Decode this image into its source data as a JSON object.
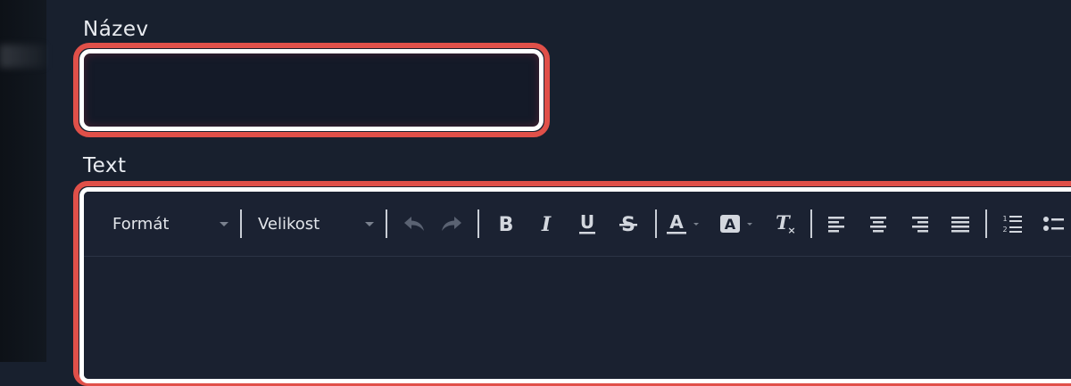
{
  "form": {
    "name_label": "Název",
    "name_value": "",
    "text_label": "Text"
  },
  "toolbar": {
    "format_label": "Formát",
    "size_label": "Velikost",
    "buttons": [
      "undo-icon",
      "redo-icon",
      "bold-icon",
      "italic-icon",
      "underline-icon",
      "strikethrough-icon",
      "text-color-icon",
      "background-color-icon",
      "clear-formatting-icon",
      "align-left-icon",
      "align-center-icon",
      "align-right-icon",
      "align-justify-icon",
      "ordered-list-icon",
      "bullet-list-icon"
    ]
  },
  "colors": {
    "focus_ring": "#e05049",
    "background": "#18202e"
  }
}
